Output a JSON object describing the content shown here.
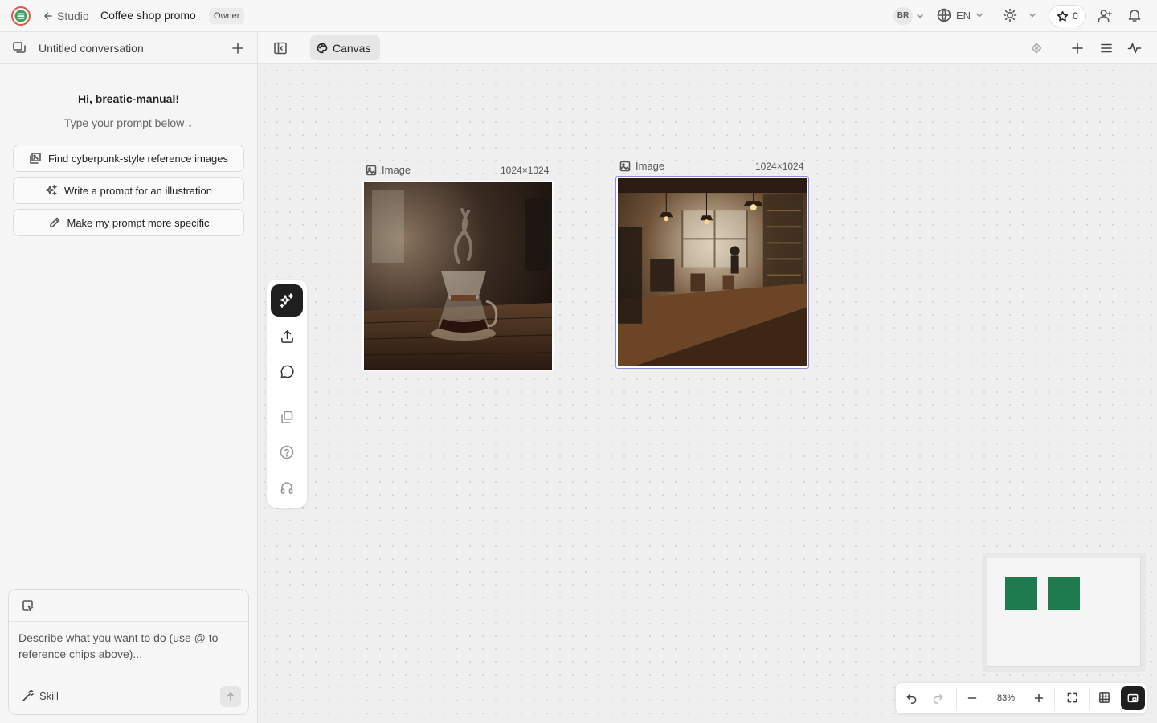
{
  "header": {
    "back_label": "Studio",
    "project_title": "Coffee shop promo",
    "role_badge": "Owner",
    "user_initials": "BR",
    "language": "EN",
    "stars_count": "0"
  },
  "conversation": {
    "title": "Untitled conversation",
    "greeting": "Hi, breatic-manual!",
    "subtitle": "Type your prompt below ↓",
    "suggestions": [
      "Find cyberpunk-style reference images",
      "Write a prompt for an illustration",
      "Make my prompt more specific"
    ],
    "input_placeholder": "Describe what you want to do (use @ to reference chips above)...",
    "skill_label": "Skill"
  },
  "canvas": {
    "tab_label": "Canvas",
    "nodes": [
      {
        "label": "Image",
        "size": "1024×1024",
        "subject": "pour-over coffee brewer"
      },
      {
        "label": "Image",
        "size": "1024×1024",
        "subject": "coffee shop interior"
      }
    ],
    "zoom_level": "83%"
  },
  "colors": {
    "accent_dark": "#1f1f1f",
    "minimap_node": "#1e7a4f",
    "selection": "#8c8cd8"
  }
}
